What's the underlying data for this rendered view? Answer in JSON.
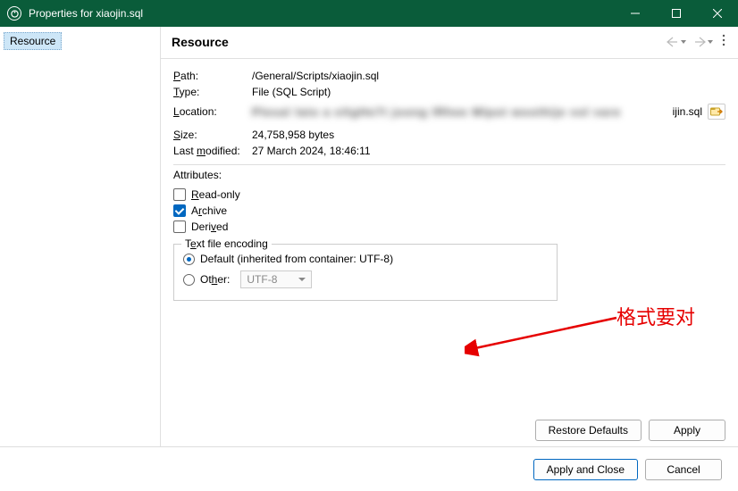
{
  "titlebar": {
    "title": "Properties for xiaojin.sql"
  },
  "sidebar": {
    "items": [
      {
        "label": "Resource"
      }
    ]
  },
  "header": {
    "title": "Resource"
  },
  "info": {
    "path_label": "Path:",
    "path_value": "/General/Scripts/xiaojin.sql",
    "type_label": "Type:",
    "type_value": "File  (SQL Script)",
    "location_label": "Location:",
    "location_suffix": "ijin.sql",
    "size_label": "Size:",
    "size_value": "24,758,958  bytes",
    "modified_label": "Last modified:",
    "modified_value": "27 March 2024, 18:46:11"
  },
  "attributes": {
    "section_label": "Attributes:",
    "readonly": {
      "label": "Read-only",
      "checked": false
    },
    "archive": {
      "label": "Archive",
      "checked": true
    },
    "derived": {
      "label": "Derived",
      "checked": false
    }
  },
  "encoding": {
    "legend": "Text file encoding",
    "default_label": "Default (inherited from container: UTF-8)",
    "other_label": "Other:",
    "other_value": "UTF-8",
    "selected": "default"
  },
  "annotation": {
    "text": "格式要对"
  },
  "buttons": {
    "restore": "Restore Defaults",
    "apply": "Apply",
    "apply_close": "Apply and Close",
    "cancel": "Cancel"
  }
}
